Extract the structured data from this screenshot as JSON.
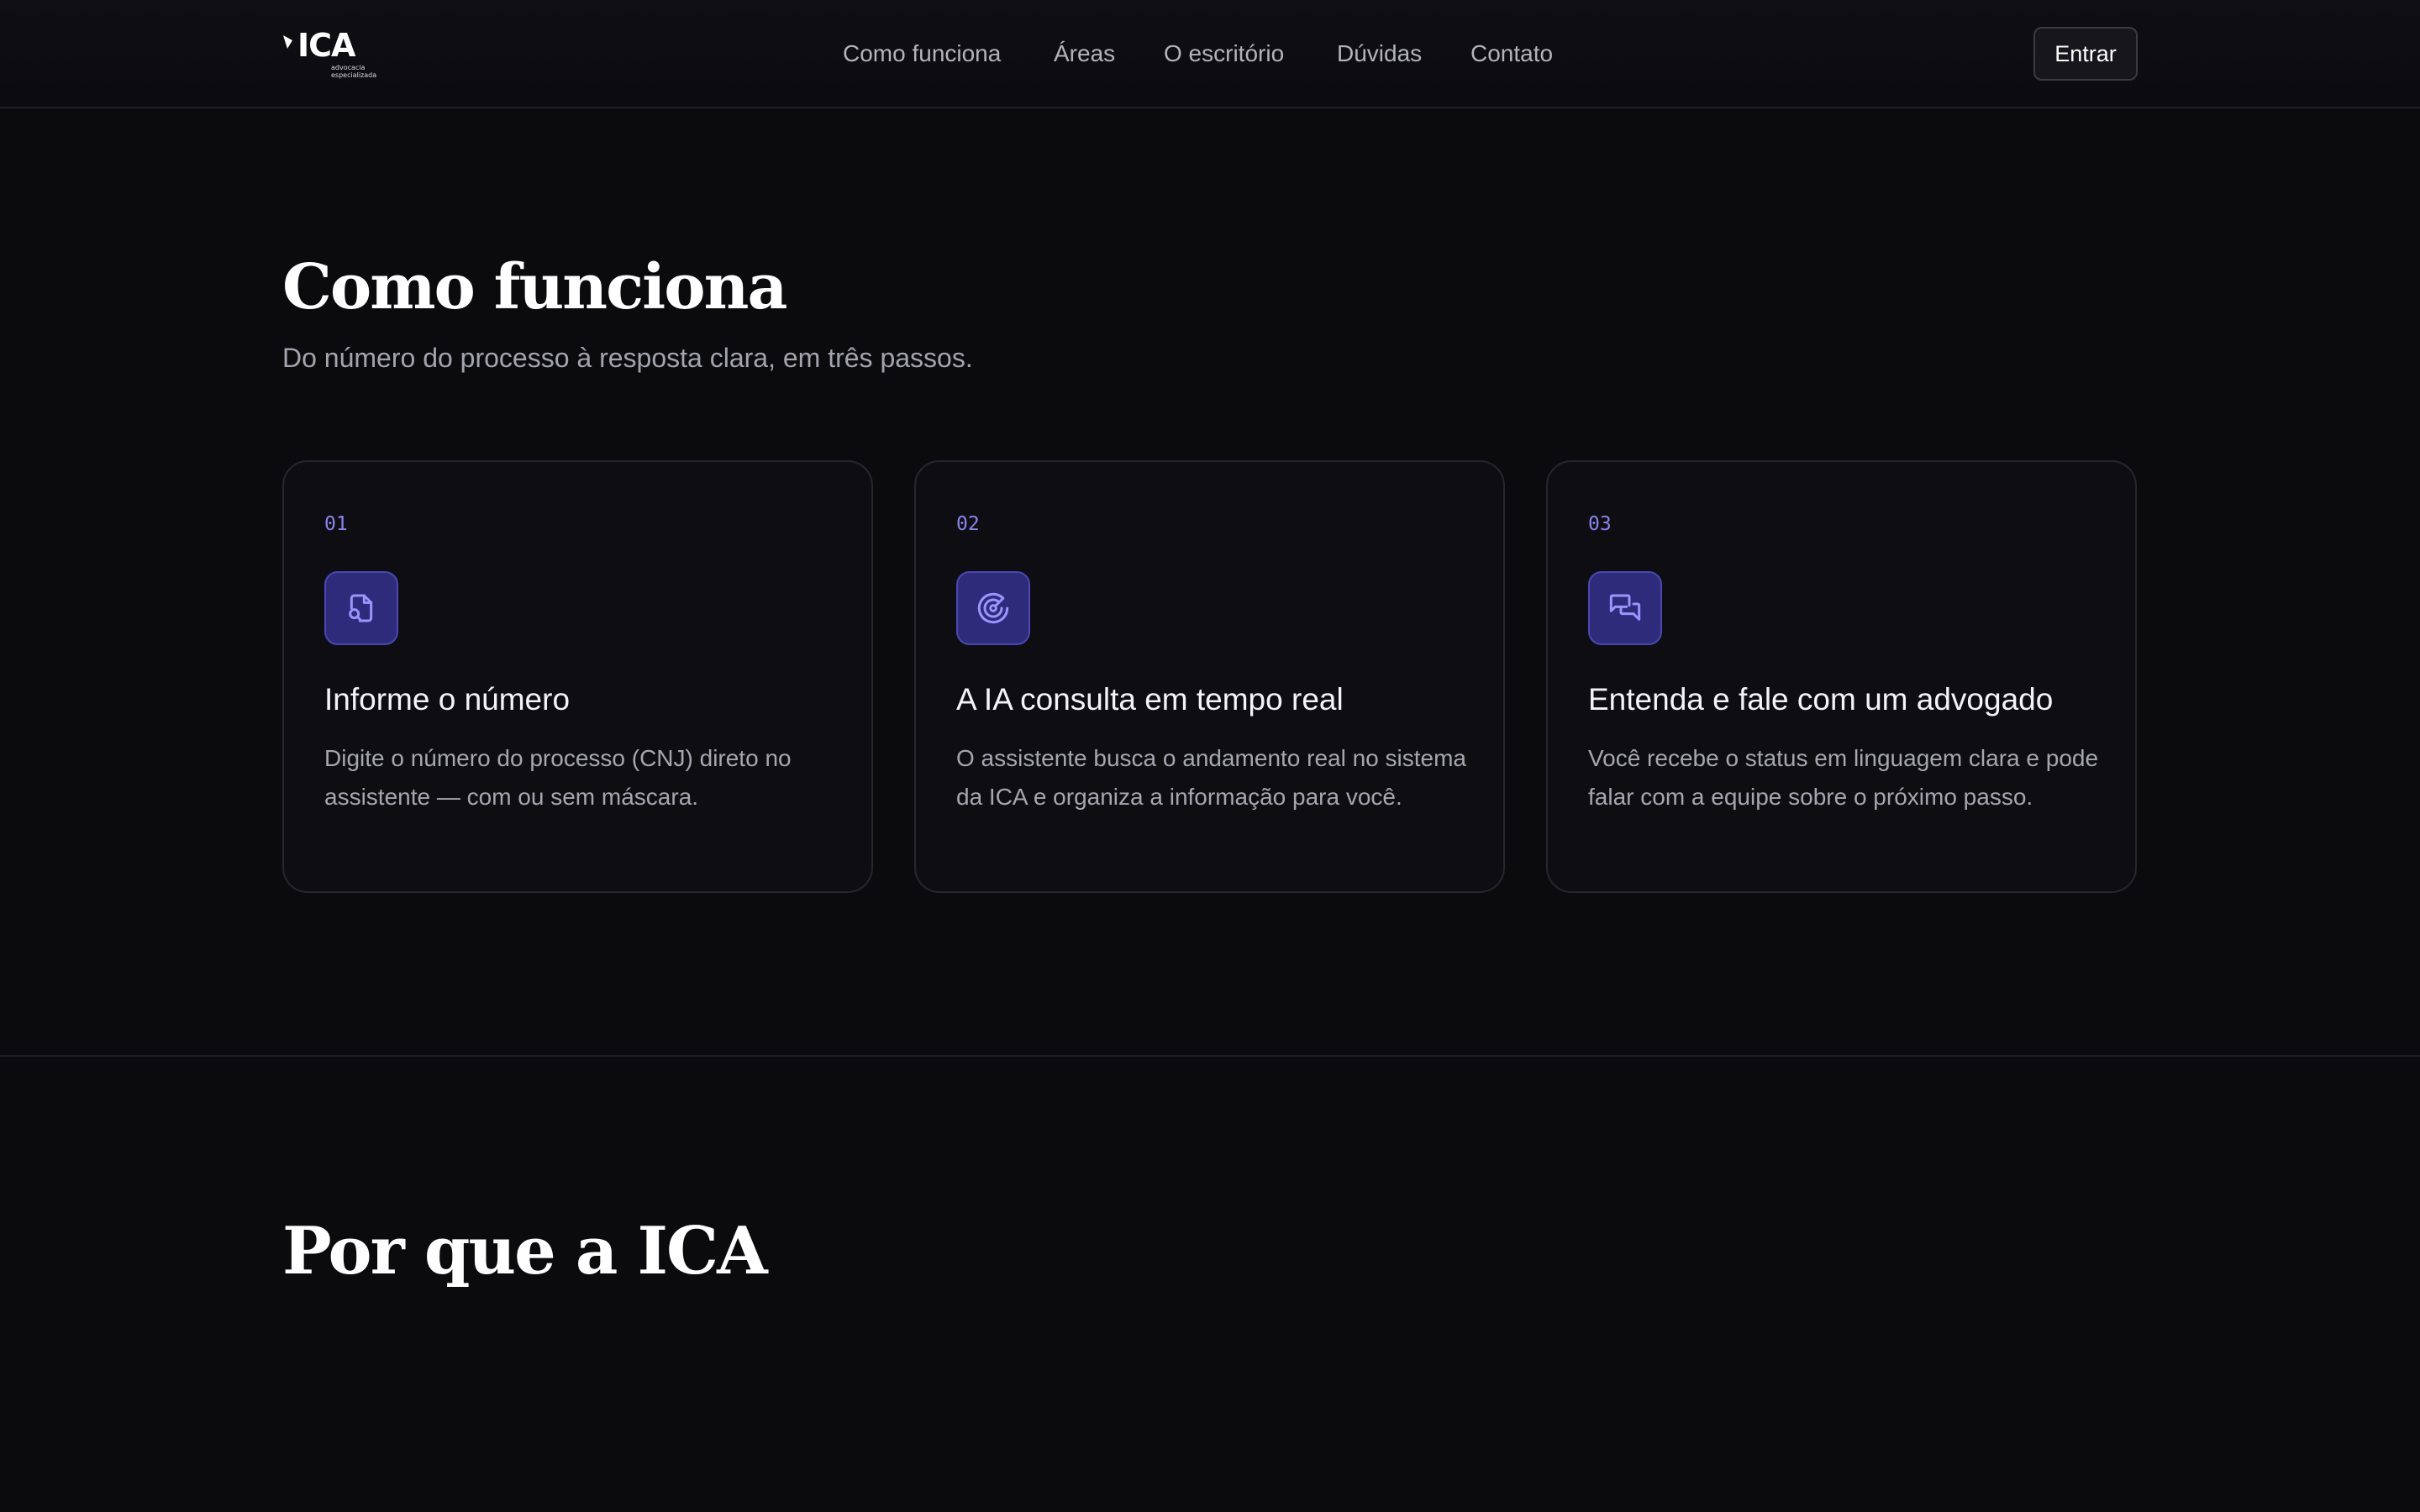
{
  "header": {
    "logo_text": "ICA",
    "logo_subtext": "advocacia\nespecializada",
    "nav": [
      {
        "label": "Como funciona"
      },
      {
        "label": "Áreas"
      },
      {
        "label": "O escritório"
      },
      {
        "label": "Dúvidas"
      },
      {
        "label": "Contato"
      }
    ],
    "login_label": "Entrar"
  },
  "how_it_works": {
    "title": "Como funciona",
    "subtitle": "Do número do processo à resposta clara, em três passos.",
    "steps": [
      {
        "number": "01",
        "icon": "file-search-icon",
        "title": "Informe o número",
        "description": "Digite o número do processo (CNJ) direto no assistente — com ou sem máscara."
      },
      {
        "number": "02",
        "icon": "radar-icon",
        "title": "A IA consulta em tempo real",
        "description": "O assistente busca o andamento real no sistema da ICA e organiza a informação para você."
      },
      {
        "number": "03",
        "icon": "chat-bubbles-icon",
        "title": "Entenda e fale com um advogado",
        "description": "Você recebe o status em linguagem clara e pode falar com a equipe sobre o próximo passo."
      }
    ]
  },
  "why_section": {
    "title": "Por que a ICA"
  },
  "colors": {
    "background": "#0b0b0e",
    "accent": "#8b83f0",
    "icon_bg": "#2e2c7a",
    "card_border": "#26262d"
  }
}
